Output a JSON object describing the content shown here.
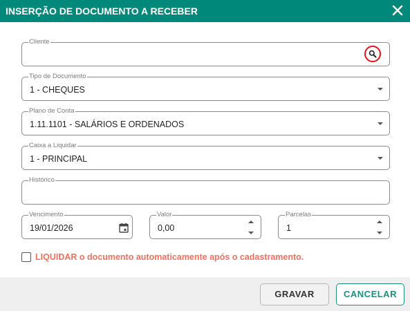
{
  "dialog": {
    "title": "INSERÇÃO DE DOCUMENTO A RECEBER"
  },
  "fields": {
    "cliente": {
      "label": "Cliente",
      "value": ""
    },
    "tipo_documento": {
      "label": "Tipo de Documento",
      "value": "1 - CHEQUES"
    },
    "plano_conta": {
      "label": "Plano de Conta",
      "value": "1.11.1101 - SALÁRIOS E ORDENADOS"
    },
    "caixa_liquidar": {
      "label": "Caixa a Liquidar",
      "value": "1 - PRINCIPAL"
    },
    "historico": {
      "label": "Histórico",
      "value": ""
    },
    "vencimento": {
      "label": "Vencimento",
      "value": "19/01/2026"
    },
    "valor": {
      "label": "Valor",
      "value": "0,00"
    },
    "parcelas": {
      "label": "Parcelas",
      "value": "1"
    }
  },
  "liquidar": {
    "checked": false,
    "label": "LIQUIDAR o documento automaticamente após o cadastramento."
  },
  "buttons": {
    "gravar": "GRAVAR",
    "cancelar": "CANCELAR"
  },
  "colors": {
    "header": "#00897b",
    "accent": "#16917f",
    "warning_text": "#f07060",
    "search_highlight": "#e30f1c"
  },
  "icons": {
    "close": "close-icon",
    "search": "search-icon",
    "dropdown": "chevron-down-icon",
    "calendar": "calendar-icon"
  }
}
